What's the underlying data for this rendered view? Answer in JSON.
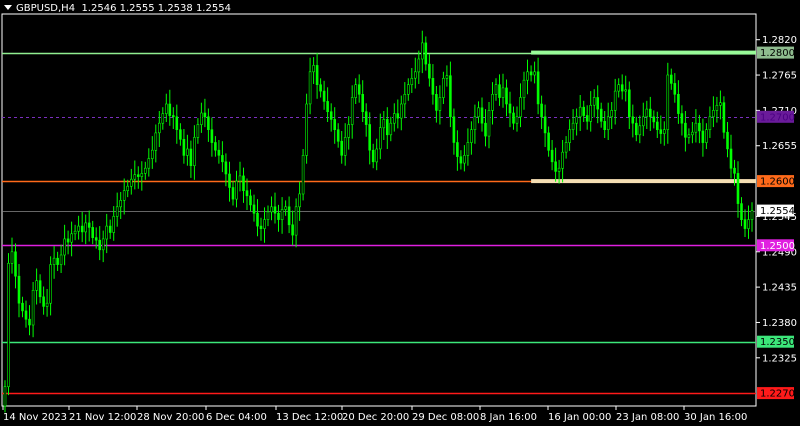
{
  "header": {
    "symbol": "GBPUSD,H4",
    "ohlc": "1.2546 1.2555 1.2538 1.2554"
  },
  "chart_data": {
    "type": "candlestick",
    "symbol": "GBPUSD",
    "timeframe": "H4",
    "ylim": [
      1.225,
      1.286
    ],
    "y_ticks": [
      "1.2820",
      "1.2765",
      "1.2710",
      "1.2655",
      "1.2545",
      "1.2490",
      "1.2435",
      "1.2380",
      "1.2325"
    ],
    "x_ticks": [
      "14 Nov 2023",
      "21 Nov 12:00",
      "28 Nov 20:00",
      "6 Dec 04:00",
      "13 Dec 12:00",
      "20 Dec 20:00",
      "29 Dec 08:00",
      "8 Jan 16:00",
      "16 Jan 00:00",
      "23 Jan 08:00",
      "30 Jan 16:00"
    ],
    "current_price": {
      "value": 1.2554,
      "label": "1.2554"
    },
    "levels": [
      {
        "value": 1.28,
        "label": "1.2800",
        "color": "#90EE90",
        "label_bg": "#8FBC8F",
        "label_fg": "#000000",
        "dash": false
      },
      {
        "value": 1.27,
        "label": "1.2700",
        "color": "#7B2FBE",
        "label_bg": "#6A1B9A",
        "label_fg": "#4B0082",
        "dash": true
      },
      {
        "value": 1.26,
        "label": "1.2600",
        "color": "#FF6A1A",
        "label_bg": "#FF6A1A",
        "label_fg": "#000000",
        "dash": false
      },
      {
        "value": 1.25,
        "label": "1.2500",
        "color": "#E020E0",
        "label_bg": "#E020E0",
        "label_fg": "#FFFFFF",
        "dash": false
      },
      {
        "value": 1.235,
        "label": "1.2350",
        "color": "#3CE67A",
        "label_bg": "#3CE67A",
        "label_fg": "#000000",
        "dash": false
      },
      {
        "value": 1.227,
        "label": "1.2270",
        "color": "#FF1A1A",
        "label_bg": "#FF1A1A",
        "label_fg": "#000000",
        "dash": false
      }
    ],
    "zones": [
      {
        "value": 1.28,
        "from_candle": 150,
        "color": "#98FB98"
      },
      {
        "value": 1.26,
        "from_candle": 150,
        "color": "#F5DEB3"
      }
    ],
    "candle_color": "#00FF00",
    "closes": [
      1.228,
      1.2472,
      1.249,
      1.2452,
      1.241,
      1.2398,
      1.2385,
      1.2376,
      1.243,
      1.2445,
      1.242,
      1.2405,
      1.241,
      1.247,
      1.248,
      1.247,
      1.2485,
      1.251,
      1.2505,
      1.2518,
      1.2522,
      1.253,
      1.2521,
      1.2535,
      1.2528,
      1.2512,
      1.2508,
      1.2493,
      1.251,
      1.253,
      1.252,
      1.2545,
      1.256,
      1.257,
      1.2585,
      1.2592,
      1.2603,
      1.261,
      1.2607,
      1.2612,
      1.262,
      1.2635,
      1.2648,
      1.2675,
      1.269,
      1.2705,
      1.272,
      1.2702,
      1.27,
      1.268,
      1.2665,
      1.264,
      1.265,
      1.2624,
      1.2668,
      1.2688,
      1.2706,
      1.27,
      1.268,
      1.266,
      1.2648,
      1.264,
      1.263,
      1.2611,
      1.259,
      1.2572,
      1.26,
      1.2608,
      1.2585,
      1.2577,
      1.2563,
      1.255,
      1.253,
      1.2526,
      1.254,
      1.2552,
      1.256,
      1.255,
      1.254,
      1.2556,
      1.256,
      1.2532,
      1.2516,
      1.256,
      1.258,
      1.264,
      1.272,
      1.277,
      1.278,
      1.275,
      1.274,
      1.2724,
      1.2708,
      1.2696,
      1.268,
      1.2662,
      1.264,
      1.2668,
      1.2688,
      1.273,
      1.275,
      1.2735,
      1.2708,
      1.2688,
      1.2648,
      1.263,
      1.265,
      1.2683,
      1.2696,
      1.2672,
      1.269,
      1.2705,
      1.2698,
      1.272,
      1.2735,
      1.275,
      1.276,
      1.277,
      1.279,
      1.2815,
      1.2782,
      1.276,
      1.2735,
      1.271,
      1.273,
      1.276,
      1.2764,
      1.27,
      1.266,
      1.2638,
      1.2628,
      1.264,
      1.266,
      1.268,
      1.27,
      1.2714,
      1.269,
      1.267,
      1.271,
      1.2735,
      1.275,
      1.273,
      1.2745,
      1.272,
      1.2706,
      1.269,
      1.27,
      1.273,
      1.2757,
      1.277,
      1.2765,
      1.277,
      1.272,
      1.27,
      1.2675,
      1.2648,
      1.263,
      1.2615,
      1.262,
      1.2645,
      1.266,
      1.268,
      1.269,
      1.27,
      1.2715,
      1.2702,
      1.2693,
      1.2718,
      1.273,
      1.2712,
      1.2693,
      1.268,
      1.27,
      1.271,
      1.274,
      1.275,
      1.274,
      1.2742,
      1.27,
      1.269,
      1.2672,
      1.2686,
      1.27,
      1.2712,
      1.27,
      1.2692,
      1.268,
      1.2674,
      1.268,
      1.2765,
      1.2752,
      1.2735,
      1.2705,
      1.269,
      1.2668,
      1.2672,
      1.2676,
      1.269,
      1.2678,
      1.266,
      1.268,
      1.27,
      1.271,
      1.2718,
      1.2722,
      1.2676,
      1.265,
      1.262,
      1.2612,
      1.2565,
      1.254,
      1.2526,
      1.254,
      1.2554
    ]
  }
}
